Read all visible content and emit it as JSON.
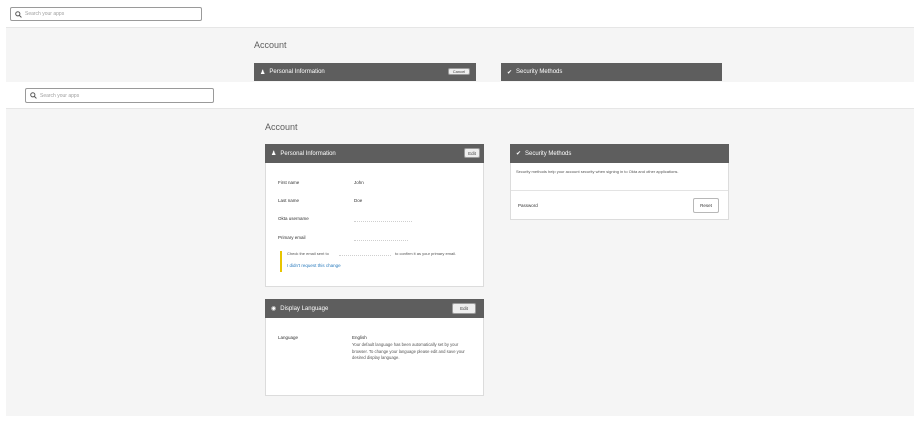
{
  "top_layer": {
    "search": {
      "placeholder": "Search your apps"
    },
    "page_title": "Account",
    "personal_info_title": "Personal Information",
    "cancel_label": "Cancel",
    "security_title": "Security Methods"
  },
  "main": {
    "search": {
      "placeholder": "Search your apps"
    },
    "page_title": "Account",
    "personal_info": {
      "title": "Personal Information",
      "edit_label": "Edit",
      "fields": [
        {
          "label": "First name",
          "value": "John"
        },
        {
          "label": "Last name",
          "value": "Doe"
        },
        {
          "label": "Okta username",
          "value": ""
        },
        {
          "label": "Primary email",
          "value": ""
        }
      ],
      "notice_prefix": "Check the email sent to",
      "notice_suffix": "to confirm it as your primary email.",
      "notice_link": "I didn't request this change"
    },
    "security": {
      "title": "Security Methods",
      "description": "Security methods help your account security when signing in to Okta and other applications.",
      "password_label": "Password",
      "reset_label": "Reset"
    },
    "display_language": {
      "title": "Display Language",
      "edit_label": "Edit",
      "language_label": "Language",
      "language_value": "English",
      "language_note": "Your default language has been automatically set by your browser. To change your language please edit and save your desired display language."
    }
  },
  "colors": {
    "card_header": "#5e5e5e",
    "page_band": "#f5f5f5",
    "notice_accent": "#e8c500",
    "link": "#2a7bbd"
  }
}
